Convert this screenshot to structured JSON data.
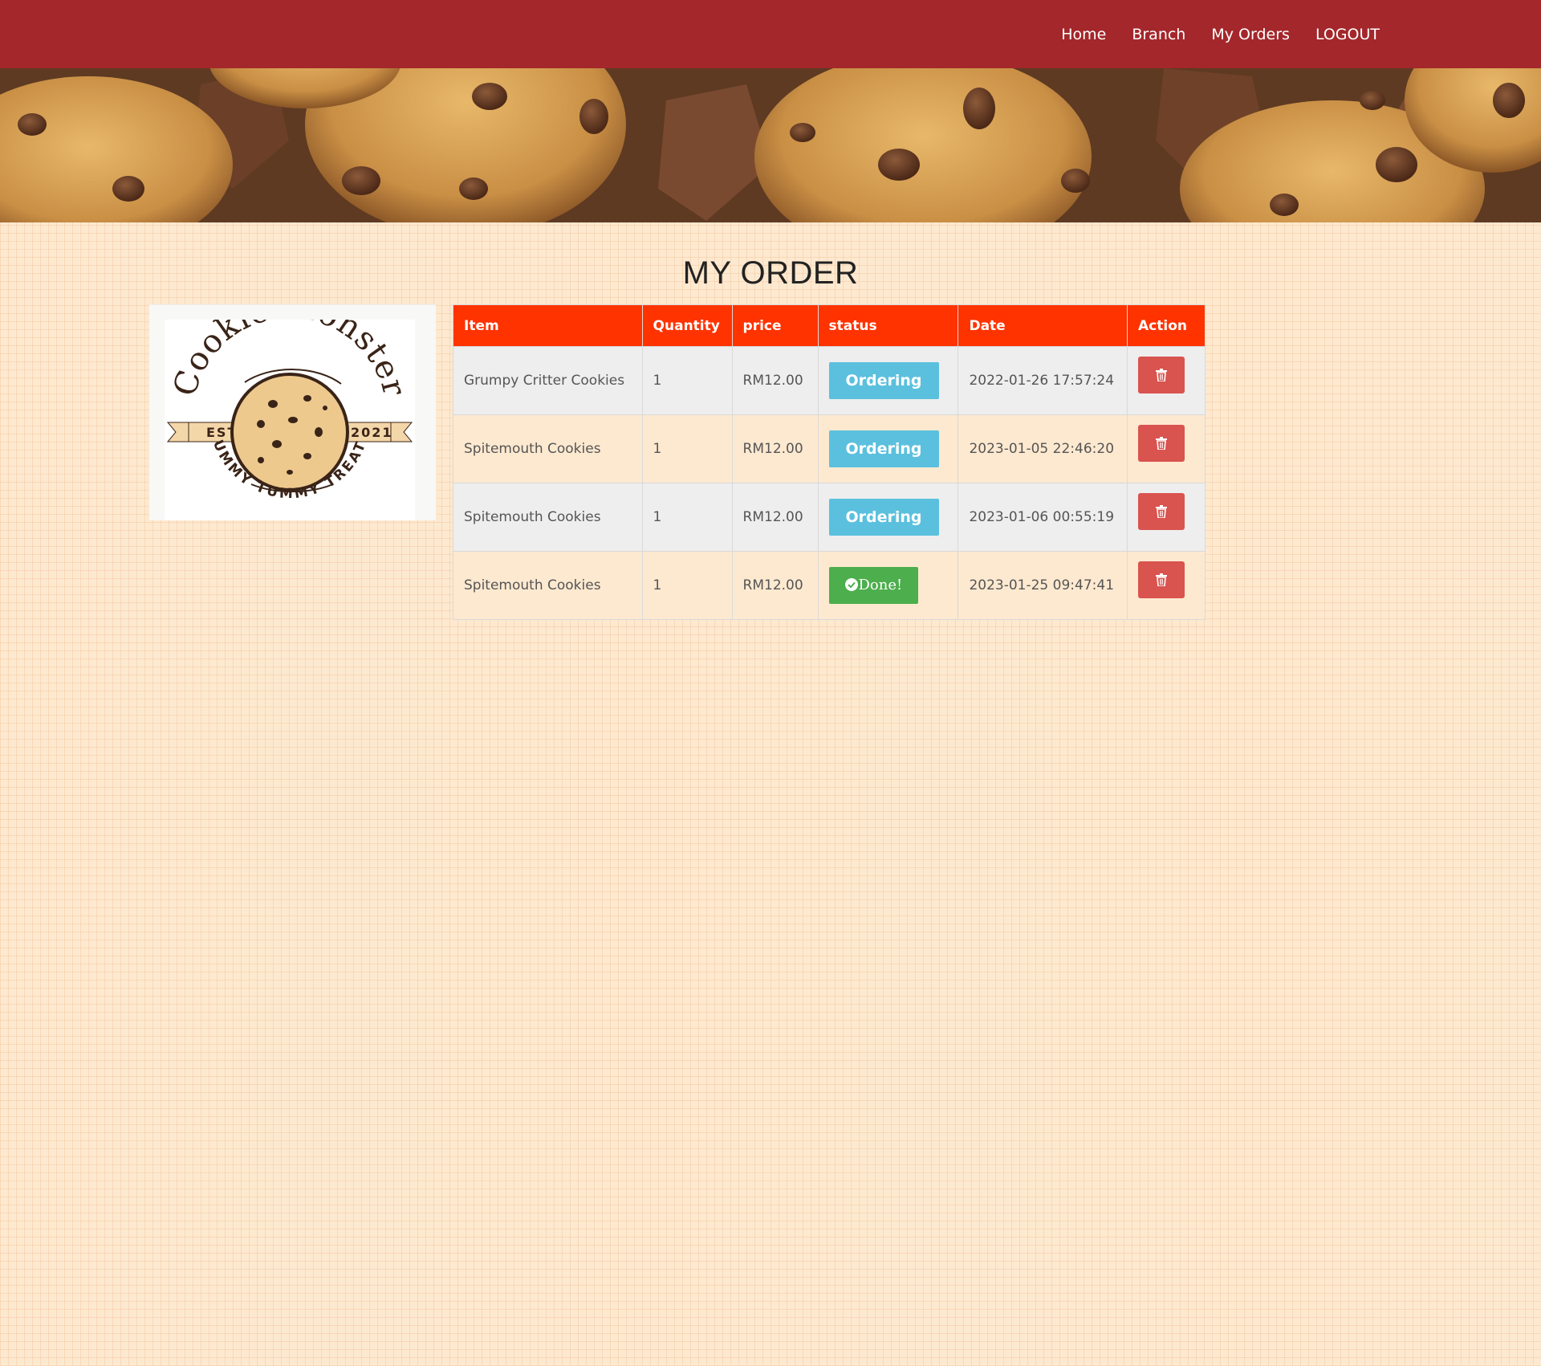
{
  "nav": {
    "items": [
      "Home",
      "Branch",
      "My Orders",
      "LOGOUT"
    ]
  },
  "hero": {
    "icon": "cookies-banner-image"
  },
  "page": {
    "title": "MY ORDER"
  },
  "logo": {
    "brand": "Cookie Monster",
    "est_label": "EST.",
    "year": "2021",
    "tagline": "YUMMY TUMMY TREATS"
  },
  "table": {
    "headers": [
      "Item",
      "Quantity",
      "price",
      "status",
      "Date",
      "Action"
    ],
    "rows": [
      {
        "item": "Grumpy Critter Cookies",
        "quantity": "1",
        "price": "RM12.00",
        "status": "Ordering",
        "date": "2022-01-26 17:57:24"
      },
      {
        "item": "Spitemouth Cookies",
        "quantity": "1",
        "price": "RM12.00",
        "status": "Ordering",
        "date": "2023-01-05 22:46:20"
      },
      {
        "item": "Spitemouth Cookies",
        "quantity": "1",
        "price": "RM12.00",
        "status": "Ordering",
        "date": "2023-01-06 00:55:19"
      },
      {
        "item": "Spitemouth Cookies",
        "quantity": "1",
        "price": "RM12.00",
        "status": "Done!",
        "date": "2023-01-25 09:47:41"
      }
    ]
  },
  "colors": {
    "navbar": "#a4272b",
    "table_header": "#ff3300",
    "ordering": "#5bc0de",
    "done": "#4cae4c",
    "delete": "#d9534f",
    "background": "#fde9d0"
  },
  "icons": {
    "delete": "trash-icon",
    "done": "check-circle-icon"
  }
}
